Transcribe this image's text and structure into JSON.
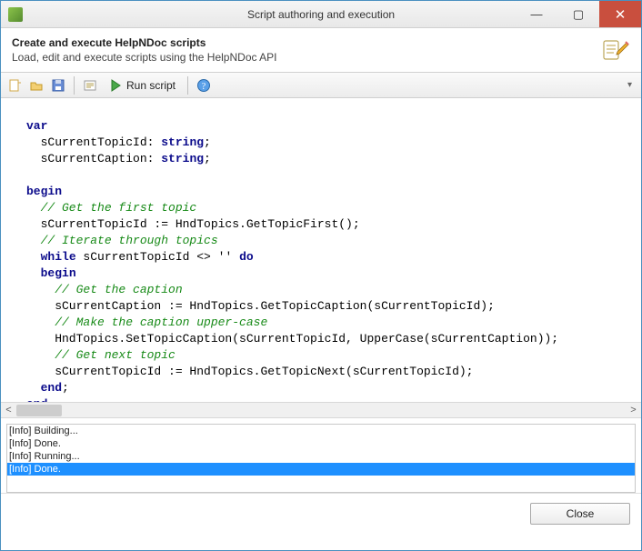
{
  "window": {
    "title": "Script authoring and execution",
    "min_tooltip": "Minimize",
    "max_tooltip": "Maximize",
    "close_tooltip": "Close"
  },
  "header": {
    "title": "Create and execute HelpNDoc scripts",
    "subtitle": "Load, edit and execute scripts using the HelpNDoc API"
  },
  "toolbar": {
    "new_tip": "New",
    "open_tip": "Open",
    "save_tip": "Save",
    "build_tip": "Build",
    "run_label": "Run script",
    "help_tip": "Help"
  },
  "code": {
    "l1a": "var",
    "l2_indent": "  sCurrentTopicId: ",
    "l2_type": "string",
    "l2_end": ";",
    "l3_indent": "  sCurrentCaption: ",
    "l3_type": "string",
    "l3_end": ";",
    "blank": "",
    "l5": "begin",
    "l6c": "  // Get the first topic",
    "l7": "  sCurrentTopicId := HndTopics.GetTopicFirst();",
    "l8c": "  // Iterate through topics",
    "l9a": "  ",
    "l9kw": "while",
    "l9b": " sCurrentTopicId <> '' ",
    "l9kw2": "do",
    "l10": "  ",
    "l10kw": "begin",
    "l11c": "    // Get the caption",
    "l12": "    sCurrentCaption := HndTopics.GetTopicCaption(sCurrentTopicId);",
    "l13c": "    // Make the caption upper-case",
    "l14": "    HndTopics.SetTopicCaption(sCurrentTopicId, UpperCase(sCurrentCaption));",
    "l15c": "    // Get next topic",
    "l16": "    sCurrentTopicId := HndTopics.GetTopicNext(sCurrentTopicId);",
    "l17": "  ",
    "l17kw": "end",
    "l17b": ";",
    "l18kw": "end",
    "l18b": "."
  },
  "output": {
    "lines": [
      "[Info] Building...",
      "[Info] Done.",
      "[Info] Running...",
      "[Info] Done."
    ]
  },
  "footer": {
    "close": "Close"
  }
}
